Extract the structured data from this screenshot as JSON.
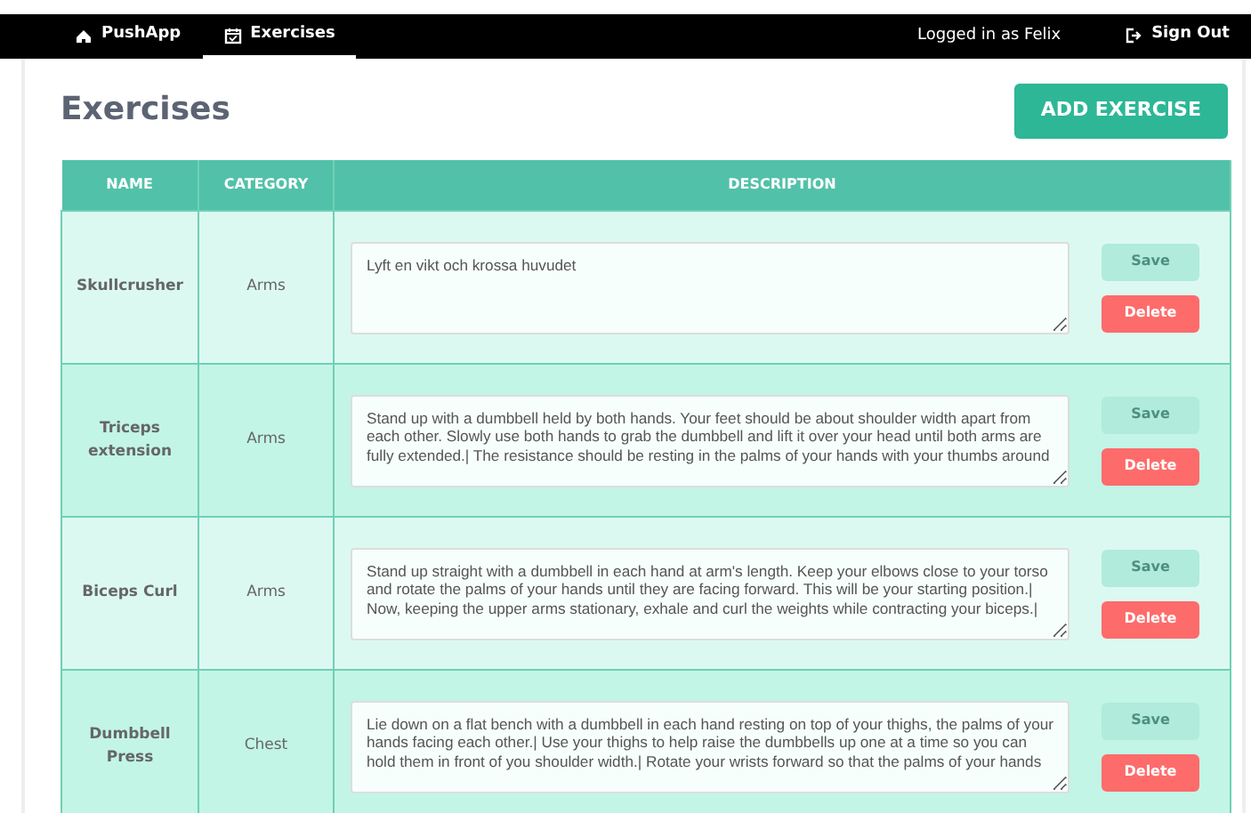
{
  "navbar": {
    "tabs": [
      {
        "label": "PushApp",
        "selected": false
      },
      {
        "label": "Exercises",
        "selected": true
      }
    ],
    "user_text": "Logged in as Felix",
    "sign_out": "Sign Out"
  },
  "heading": "Exercises",
  "add_button": "ADD EXERCISE",
  "table": {
    "columns": [
      "NAME",
      "CATEGORY",
      "DESCRIPTION"
    ],
    "rows": [
      {
        "name": "Skullcrusher",
        "category": "Arms",
        "description": "Lyft en vikt och krossa huvudet",
        "save": "Save",
        "save_disabled": true,
        "delete": "Delete"
      },
      {
        "name": "Triceps extension",
        "category": "Arms",
        "description": "Stand up with a dumbbell held by both hands. Your feet should be about shoulder width apart from each other. Slowly use both hands to grab the dumbbell and lift it over your head until both arms are fully extended.| The resistance should be resting in the palms of your hands with your thumbs around",
        "save": "Save",
        "save_disabled": true,
        "delete": "Delete"
      },
      {
        "name": "Biceps Curl",
        "category": "Arms",
        "description": "Stand up straight with a dumbbell in each hand at arm's length. Keep your elbows close to your torso and rotate the palms of your hands until they are facing forward. This will be your starting position.| Now, keeping the upper arms stationary, exhale and curl the weights while contracting your biceps.|",
        "save": "Save",
        "save_disabled": true,
        "delete": "Delete"
      },
      {
        "name": "Dumbbell Press",
        "category": "Chest",
        "description": "Lie down on a flat bench with a dumbbell in each hand resting on top of your thighs, the palms of your hands facing each other.| Use your thighs to help raise the dumbbells up one at a time so you can hold them in front of you shoulder width.| Rotate your wrists forward so that the palms of your hands",
        "save": "Save",
        "save_disabled": true,
        "delete": "Delete"
      }
    ]
  }
}
